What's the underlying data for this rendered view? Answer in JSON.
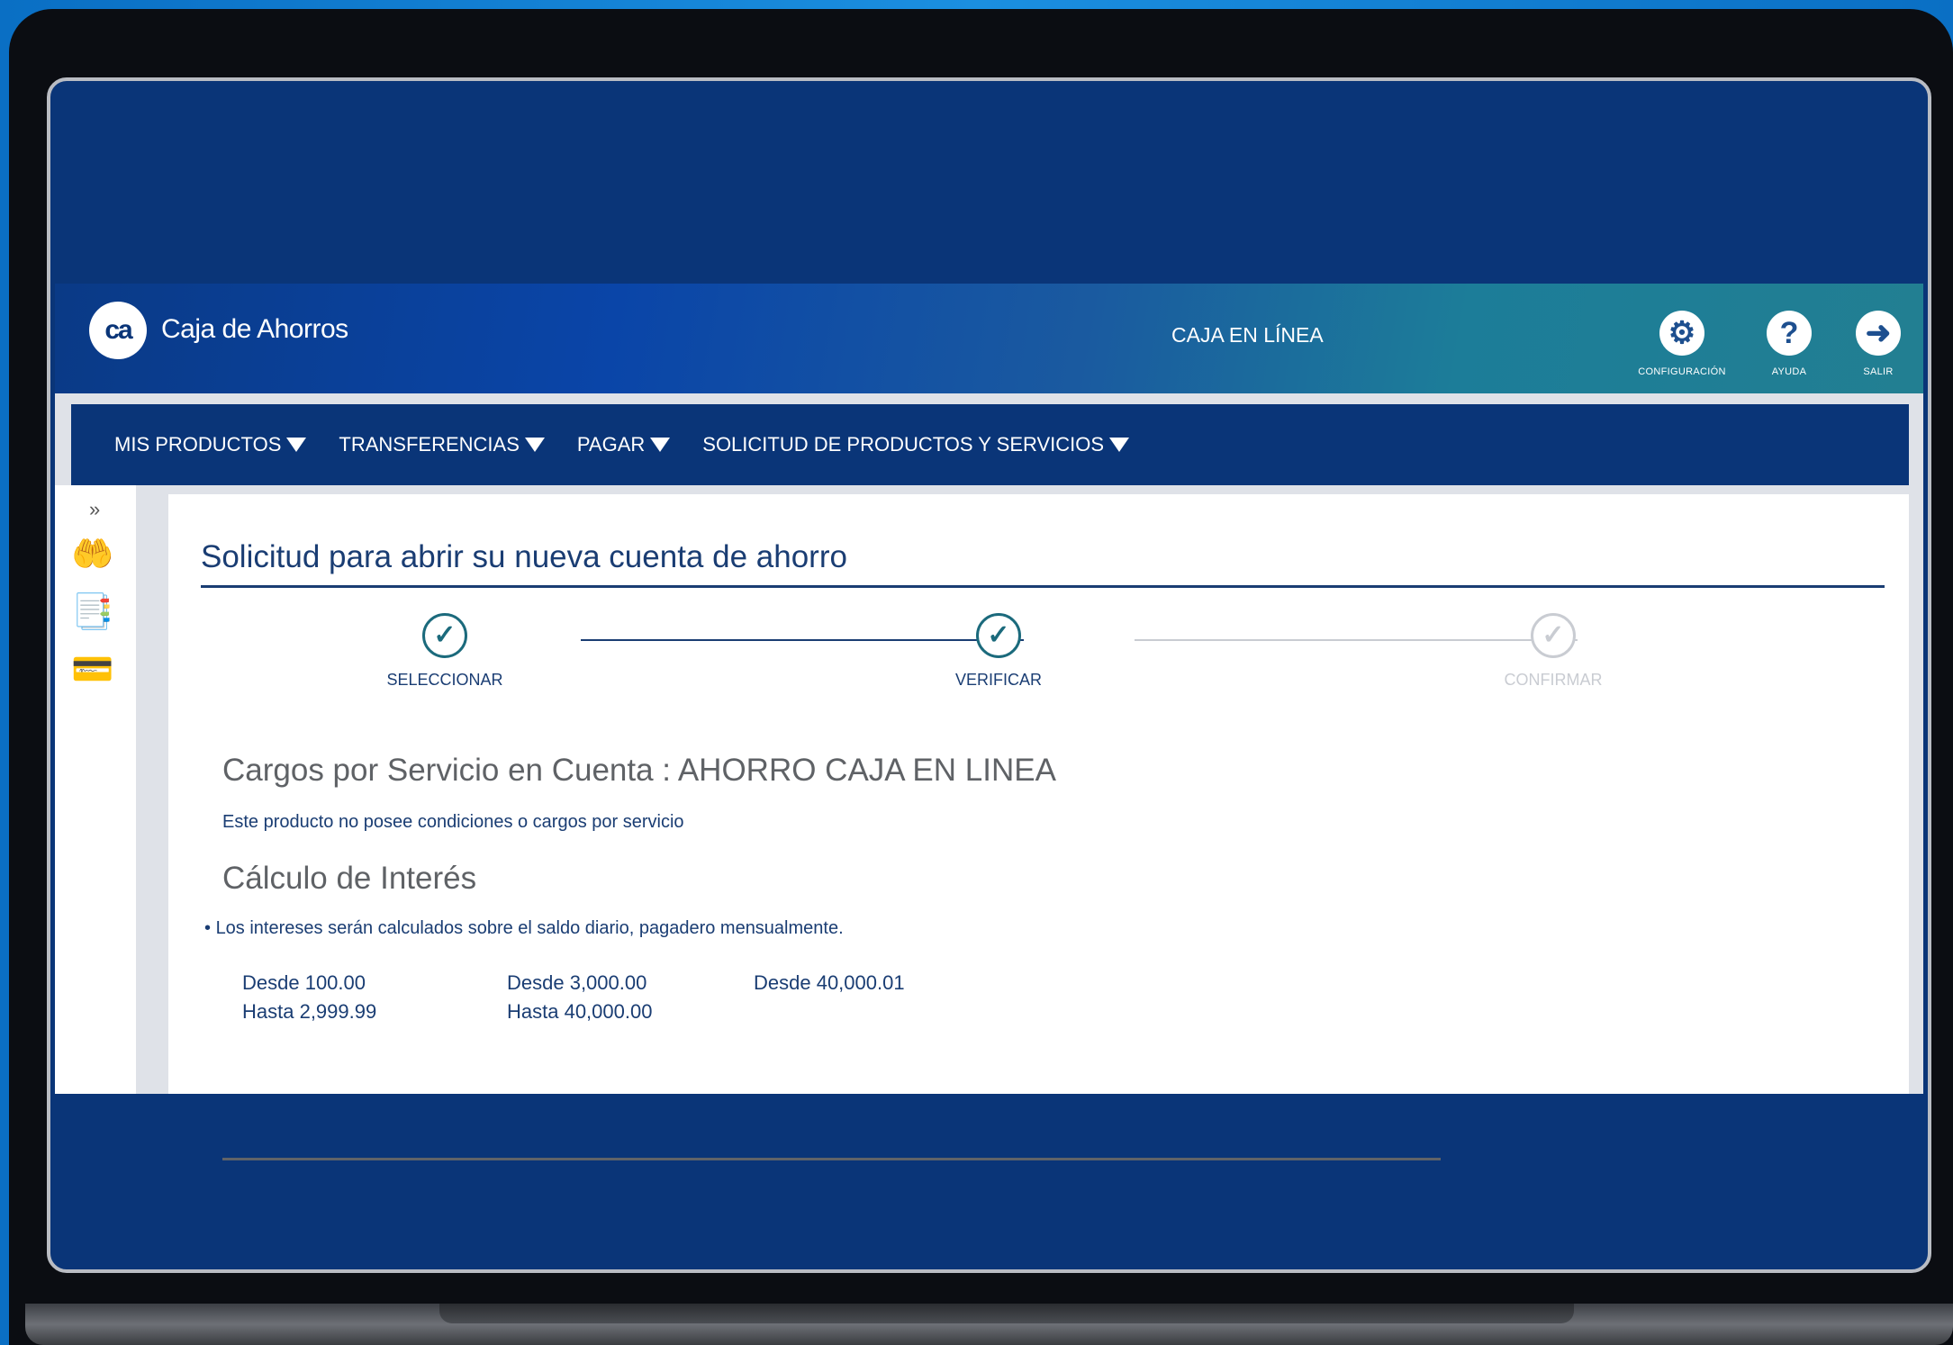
{
  "header": {
    "logo_initials": "ca",
    "logo_text": "Caja de Ahorros",
    "app_title": "CAJA EN LÍNEA",
    "actions": [
      {
        "label": "CONFIGURACIÓN",
        "icon": "gear-icon",
        "glyph": "⚙"
      },
      {
        "label": "AYUDA",
        "icon": "help-icon",
        "glyph": "?"
      },
      {
        "label": "SALIR",
        "icon": "logout-arrow-icon",
        "glyph": "➜"
      }
    ]
  },
  "nav": {
    "items": [
      {
        "label": "MIS PRODUCTOS"
      },
      {
        "label": "TRANSFERENCIAS"
      },
      {
        "label": "PAGAR"
      },
      {
        "label": "SOLICITUD DE PRODUCTOS Y SERVICIOS"
      }
    ]
  },
  "sidebar": {
    "expand_glyph": "»",
    "icons": [
      {
        "name": "hand-money-icon",
        "glyph": "🤲"
      },
      {
        "name": "hand-documents-icon",
        "glyph": "📑"
      },
      {
        "name": "hand-card-icon",
        "glyph": "💳"
      }
    ]
  },
  "page": {
    "title": "Solicitud para abrir su nueva cuenta de ahorro",
    "steps": [
      {
        "label": "SELECCIONAR",
        "state": "completed"
      },
      {
        "label": "VERIFICAR",
        "state": "completed"
      },
      {
        "label": "CONFIRMAR",
        "state": "pending"
      }
    ],
    "charges_title": "Cargos por Servicio en Cuenta : AHORRO CAJA EN LINEA",
    "charges_text": "Este producto no posee condiciones o cargos por servicio",
    "interest_title": "Cálculo de Interés",
    "interest_note": "Los intereses serán calculados sobre el saldo diario, pagadero mensualmente.",
    "rate_tiers": [
      {
        "from": "Desde 100.00",
        "to": "Hasta 2,999.99"
      },
      {
        "from": "Desde 3,000.00",
        "to": "Hasta 40,000.00"
      },
      {
        "from": "Desde 40,000.01",
        "to": ""
      }
    ]
  },
  "colors": {
    "primary_navy": "#0a3578",
    "accent_teal": "#1b6a7c",
    "inactive_grey": "#c9ccd2"
  }
}
